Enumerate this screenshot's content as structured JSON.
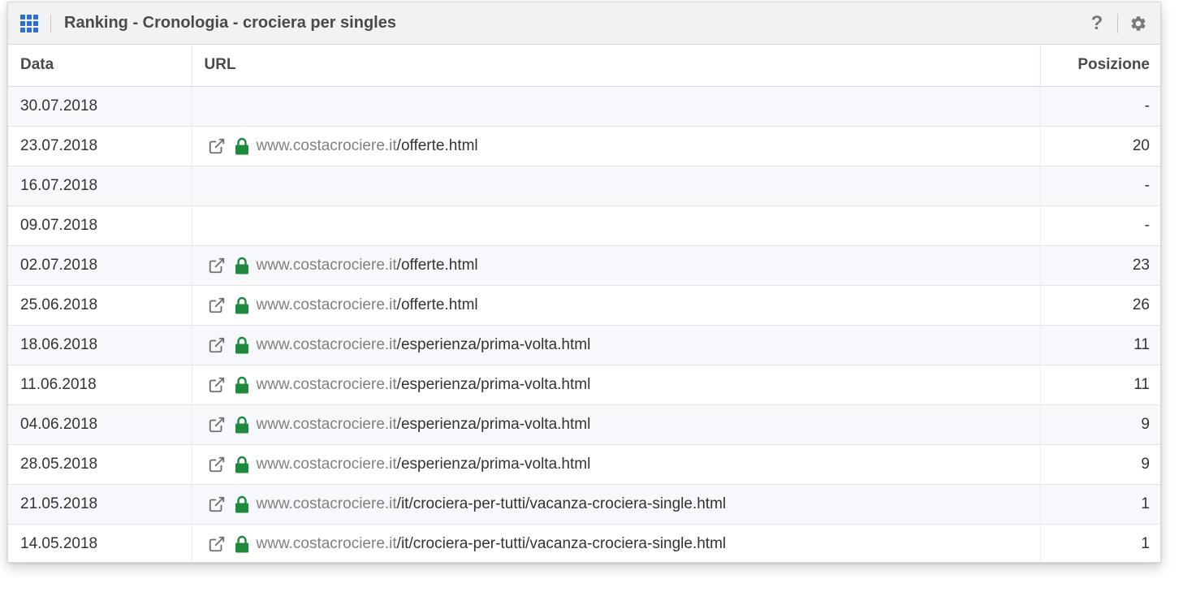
{
  "widget": {
    "title": "Ranking - Cronologia - crociera per singles",
    "help_label": "?"
  },
  "table": {
    "headers": {
      "data": "Data",
      "url": "URL",
      "position": "Posizione"
    },
    "rows": [
      {
        "date": "30.07.2018",
        "domain": "",
        "path": "",
        "position": "-"
      },
      {
        "date": "23.07.2018",
        "domain": "www.costacrociere.it",
        "path": "/offerte.html",
        "position": "20"
      },
      {
        "date": "16.07.2018",
        "domain": "",
        "path": "",
        "position": "-"
      },
      {
        "date": "09.07.2018",
        "domain": "",
        "path": "",
        "position": "-"
      },
      {
        "date": "02.07.2018",
        "domain": "www.costacrociere.it",
        "path": "/offerte.html",
        "position": "23"
      },
      {
        "date": "25.06.2018",
        "domain": "www.costacrociere.it",
        "path": "/offerte.html",
        "position": "26"
      },
      {
        "date": "18.06.2018",
        "domain": "www.costacrociere.it",
        "path": "/esperienza/prima-volta.html",
        "position": "11"
      },
      {
        "date": "11.06.2018",
        "domain": "www.costacrociere.it",
        "path": "/esperienza/prima-volta.html",
        "position": "11"
      },
      {
        "date": "04.06.2018",
        "domain": "www.costacrociere.it",
        "path": "/esperienza/prima-volta.html",
        "position": "9"
      },
      {
        "date": "28.05.2018",
        "domain": "www.costacrociere.it",
        "path": "/esperienza/prima-volta.html",
        "position": "9"
      },
      {
        "date": "21.05.2018",
        "domain": "www.costacrociere.it",
        "path": "/it/crociera-per-tutti/vacanza-crociera-single.html",
        "position": "1"
      },
      {
        "date": "14.05.2018",
        "domain": "www.costacrociere.it",
        "path": "/it/crociera-per-tutti/vacanza-crociera-single.html",
        "position": "1"
      }
    ]
  },
  "icons": {
    "menu": "grid-icon",
    "help": "help-icon",
    "settings": "gear-icon",
    "external_link": "external-link-icon",
    "secure": "lock-icon"
  },
  "colors": {
    "accent_blue": "#2f6fd3",
    "lock_green": "#1e8a3c",
    "domain_gray": "#808080",
    "row_stripe": "#f6f8fb"
  }
}
